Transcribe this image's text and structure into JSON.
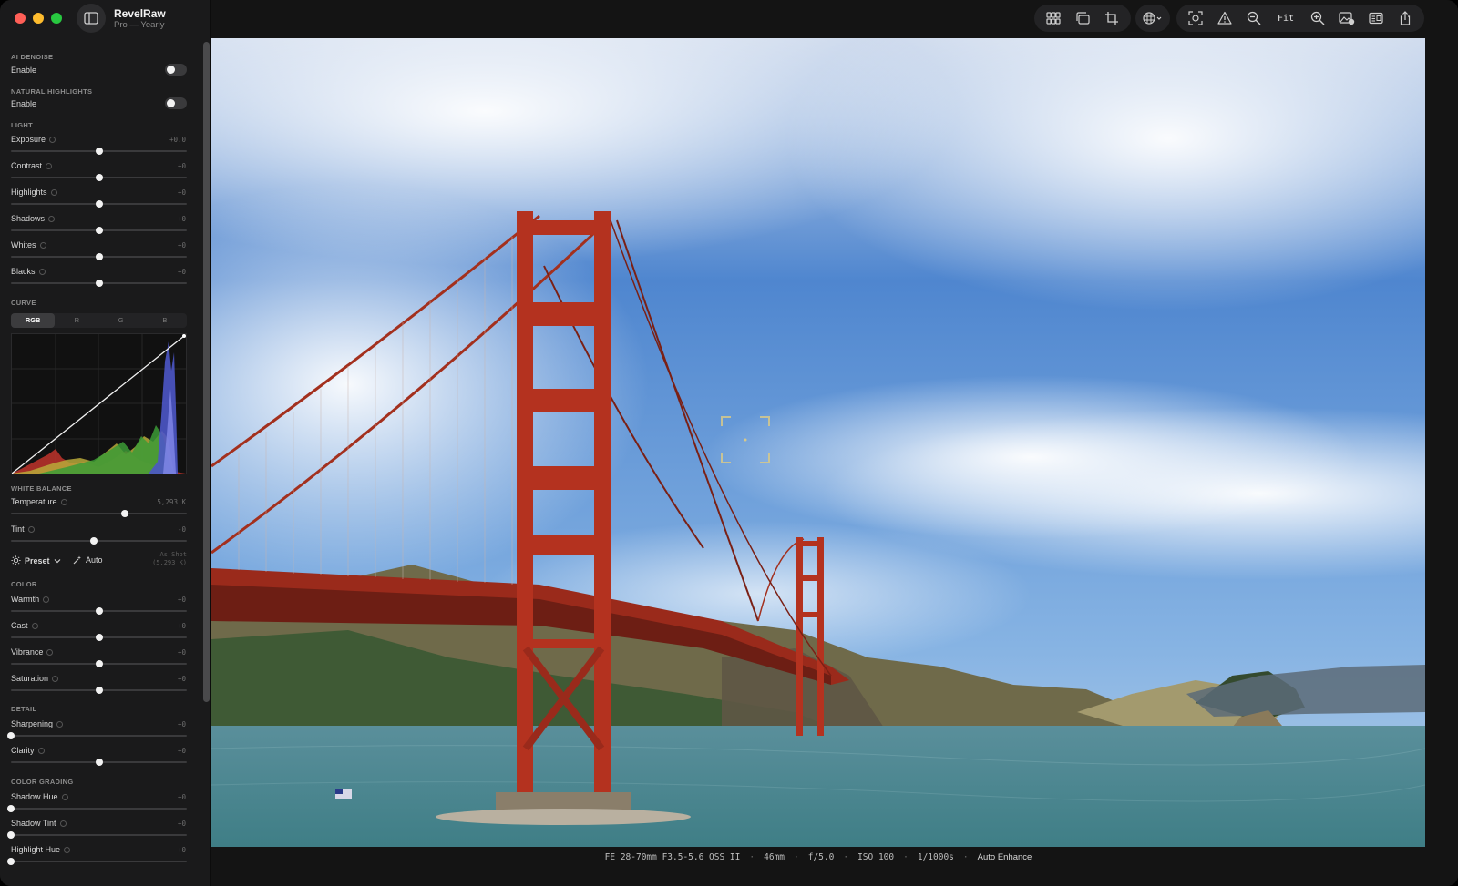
{
  "app": {
    "name": "RevelRaw",
    "plan": "Pro — Yearly"
  },
  "sidebar": {
    "ai_denoise": {
      "title": "AI DENOISE",
      "label": "Enable",
      "enabled": false
    },
    "natural_highlights": {
      "title": "NATURAL HIGHLIGHTS",
      "label": "Enable",
      "enabled": false
    },
    "light": {
      "title": "LIGHT",
      "sliders": [
        {
          "label": "Exposure",
          "value": "+0.0",
          "level": 0.5
        },
        {
          "label": "Contrast",
          "value": "+0",
          "level": 0.5
        },
        {
          "label": "Highlights",
          "value": "+0",
          "level": 0.5
        },
        {
          "label": "Shadows",
          "value": "+0",
          "level": 0.5
        },
        {
          "label": "Whites",
          "value": "+0",
          "level": 0.5
        },
        {
          "label": "Blacks",
          "value": "+0",
          "level": 0.5
        }
      ]
    },
    "curve": {
      "title": "CURVE",
      "tabs": [
        "RGB",
        "R",
        "G",
        "B"
      ],
      "active_tab": "RGB"
    },
    "white_balance": {
      "title": "WHITE BALANCE",
      "sliders": [
        {
          "label": "Temperature",
          "value": "5,293 K",
          "level": 0.65
        },
        {
          "label": "Tint",
          "value": "-0",
          "level": 0.47
        }
      ],
      "preset_label": "Preset",
      "auto_label": "Auto",
      "as_shot_line1": "As Shot",
      "as_shot_line2": "(5,293 K)"
    },
    "color": {
      "title": "COLOR",
      "sliders": [
        {
          "label": "Warmth",
          "value": "+0",
          "level": 0.5
        },
        {
          "label": "Cast",
          "value": "+0",
          "level": 0.5
        },
        {
          "label": "Vibrance",
          "value": "+0",
          "level": 0.5
        },
        {
          "label": "Saturation",
          "value": "+0",
          "level": 0.5
        }
      ]
    },
    "detail": {
      "title": "DETAIL",
      "sliders": [
        {
          "label": "Sharpening",
          "value": "+0",
          "level": 0.0
        },
        {
          "label": "Clarity",
          "value": "+0",
          "level": 0.5
        }
      ]
    },
    "color_grading": {
      "title": "COLOR GRADING",
      "sliders": [
        {
          "label": "Shadow Hue",
          "value": "+0",
          "level": 0.0
        },
        {
          "label": "Shadow Tint",
          "value": "+0",
          "level": 0.0
        },
        {
          "label": "Highlight Hue",
          "value": "+0",
          "level": 0.0
        }
      ]
    }
  },
  "toolbar": {
    "fit_label": "Fit",
    "icons": [
      "grid-icon",
      "compare-icon",
      "crop-icon",
      "overlay-menu-icon",
      "focus-icon",
      "warning-icon",
      "zoom-out-icon",
      "zoom-in-icon",
      "photo-badge-icon",
      "info-card-icon",
      "share-icon"
    ]
  },
  "status": {
    "lens": "FE 28-70mm F3.5-5.6 OSS II",
    "focal": "46mm",
    "aperture": "f/5.0",
    "iso": "ISO 100",
    "shutter": "1/1000s",
    "enhance": "Auto Enhance"
  },
  "colors": {
    "accent": "#f2f2f2",
    "bridge": "#b4321f",
    "sky": "#4f86cf",
    "water": "#4b8a92"
  }
}
